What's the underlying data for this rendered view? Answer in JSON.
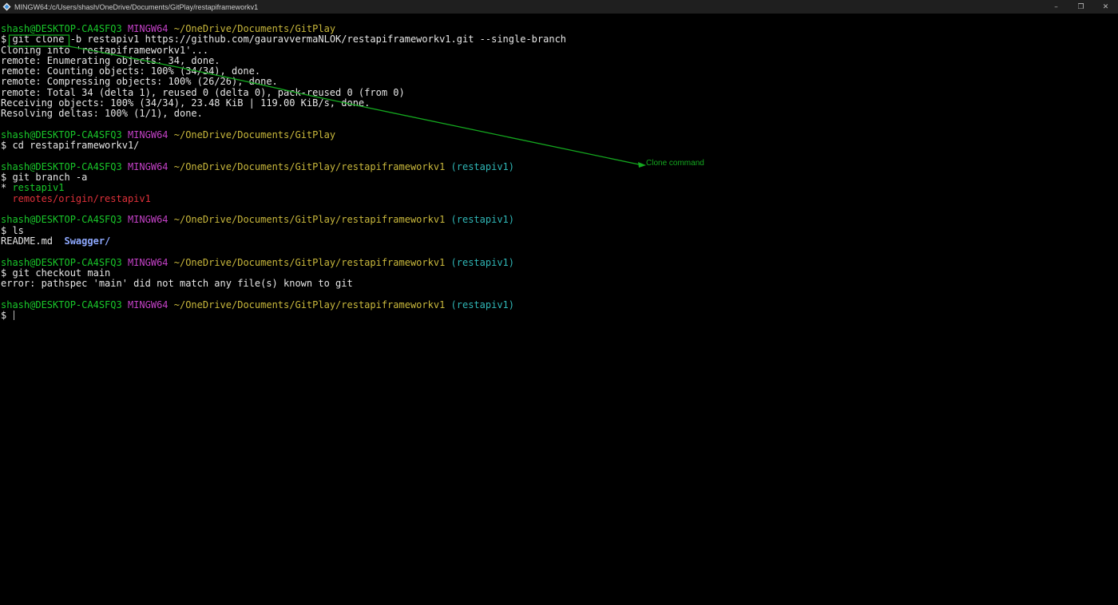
{
  "window": {
    "title": "MINGW64:/c/Users/shash/OneDrive/Documents/GitPlay/restapiframeworkv1",
    "icon": "git-bash-icon",
    "controls": {
      "minimize": "–",
      "maximize": "❐",
      "close": "✕"
    }
  },
  "colors": {
    "background": "#000000",
    "user_host": "#19c82a",
    "msystem": "#c341c6",
    "path": "#c9b83c",
    "branch": "#2fb6b6",
    "remote_branch": "#e0313a",
    "annotation": "#14a81f"
  },
  "terminal": {
    "lines": [
      {
        "segments": [
          {
            "text": "shash@DESKTOP-CA4SFQ3 ",
            "color": "green"
          },
          {
            "text": "MINGW64 ",
            "color": "magenta"
          },
          {
            "text": "~/OneDrive/Documents/GitPlay",
            "color": "yellow"
          }
        ]
      },
      {
        "segments": [
          {
            "text": "$ "
          },
          {
            "text": "git clone"
          },
          {
            "text": " -b restapiv1 https://github.com/gauravvermaNLOK/restapiframeworkv1.git --single-branch"
          }
        ]
      },
      {
        "segments": [
          {
            "text": "Cloning into 'restapiframeworkv1'..."
          }
        ]
      },
      {
        "segments": [
          {
            "text": "remote: Enumerating objects: 34, done."
          }
        ]
      },
      {
        "segments": [
          {
            "text": "remote: Counting objects: 100% (34/34), done."
          }
        ]
      },
      {
        "segments": [
          {
            "text": "remote: Compressing objects: 100% (26/26), done."
          }
        ]
      },
      {
        "segments": [
          {
            "text": "remote: Total 34 (delta 1), reused 0 (delta 0), pack-reused 0 (from 0)"
          }
        ]
      },
      {
        "segments": [
          {
            "text": "Receiving objects: 100% (34/34), 23.48 KiB | 119.00 KiB/s, done."
          }
        ]
      },
      {
        "segments": [
          {
            "text": "Resolving deltas: 100% (1/1), done."
          }
        ]
      },
      {
        "segments": [
          {
            "text": ""
          }
        ]
      },
      {
        "segments": [
          {
            "text": "shash@DESKTOP-CA4SFQ3 ",
            "color": "green"
          },
          {
            "text": "MINGW64 ",
            "color": "magenta"
          },
          {
            "text": "~/OneDrive/Documents/GitPlay",
            "color": "yellow"
          }
        ]
      },
      {
        "segments": [
          {
            "text": "$ cd restapiframeworkv1/"
          }
        ]
      },
      {
        "segments": [
          {
            "text": ""
          }
        ]
      },
      {
        "segments": [
          {
            "text": "shash@DESKTOP-CA4SFQ3 ",
            "color": "green"
          },
          {
            "text": "MINGW64 ",
            "color": "magenta"
          },
          {
            "text": "~/OneDrive/Documents/GitPlay/restapiframeworkv1",
            "color": "yellow"
          },
          {
            "text": " (restapiv1)",
            "color": "cyan"
          }
        ]
      },
      {
        "segments": [
          {
            "text": "$ git branch -a"
          }
        ]
      },
      {
        "segments": [
          {
            "text": "* "
          },
          {
            "text": "restapiv1",
            "color": "green"
          }
        ]
      },
      {
        "segments": [
          {
            "text": "  "
          },
          {
            "text": "remotes/origin/restapiv1",
            "color": "red"
          }
        ]
      },
      {
        "segments": [
          {
            "text": ""
          }
        ]
      },
      {
        "segments": [
          {
            "text": "shash@DESKTOP-CA4SFQ3 ",
            "color": "green"
          },
          {
            "text": "MINGW64 ",
            "color": "magenta"
          },
          {
            "text": "~/OneDrive/Documents/GitPlay/restapiframeworkv1",
            "color": "yellow"
          },
          {
            "text": " (restapiv1)",
            "color": "cyan"
          }
        ]
      },
      {
        "segments": [
          {
            "text": "$ ls"
          }
        ]
      },
      {
        "segments": [
          {
            "text": "README.md  "
          },
          {
            "text": "Swagger/",
            "color": "blue"
          }
        ]
      },
      {
        "segments": [
          {
            "text": ""
          }
        ]
      },
      {
        "segments": [
          {
            "text": "shash@DESKTOP-CA4SFQ3 ",
            "color": "green"
          },
          {
            "text": "MINGW64 ",
            "color": "magenta"
          },
          {
            "text": "~/OneDrive/Documents/GitPlay/restapiframeworkv1",
            "color": "yellow"
          },
          {
            "text": " (restapiv1)",
            "color": "cyan"
          }
        ]
      },
      {
        "segments": [
          {
            "text": "$ git checkout main"
          }
        ]
      },
      {
        "segments": [
          {
            "text": "error: pathspec 'main' did not match any file(s) known to git"
          }
        ]
      },
      {
        "segments": [
          {
            "text": ""
          }
        ]
      },
      {
        "segments": [
          {
            "text": "shash@DESKTOP-CA4SFQ3 ",
            "color": "green"
          },
          {
            "text": "MINGW64 ",
            "color": "magenta"
          },
          {
            "text": "~/OneDrive/Documents/GitPlay/restapiframeworkv1",
            "color": "yellow"
          },
          {
            "text": " (restapiv1)",
            "color": "cyan"
          }
        ]
      },
      {
        "segments": [
          {
            "text": "$ "
          }
        ],
        "cursor": true
      }
    ]
  },
  "annotation": {
    "label": "Clone command",
    "highlighted_text": "git clone"
  }
}
